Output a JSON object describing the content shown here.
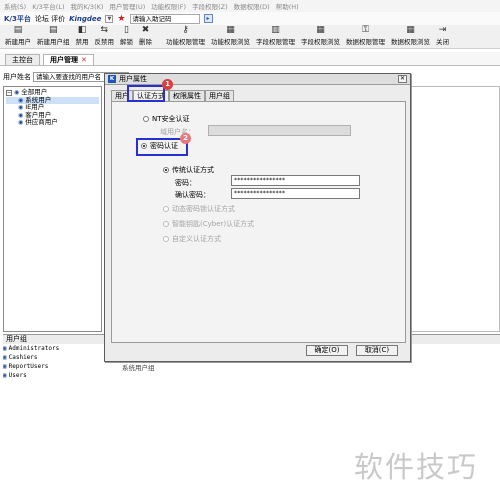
{
  "menubar": [
    "系统(S)",
    "K/3平台(L)",
    "我的K/3(K)",
    "用户管理(U)",
    "功能权限(F)",
    "字段权限(Z)",
    "数据权限(D)",
    "帮助(H)"
  ],
  "brand": {
    "name": "K/3平台",
    "links": "论坛 评价",
    "logo": "Kingdee",
    "quick_placeholder": "请输入助记码"
  },
  "toolbar": [
    "新建用户",
    "新建用户组",
    "禁用",
    "反禁用",
    "解锁",
    "删除",
    "功能权限管理",
    "功能权限浏览",
    "字段权限管理",
    "字段权限浏览",
    "数据权限管理",
    "数据权限浏览",
    "关闭"
  ],
  "doc_tabs": {
    "console": "主控台",
    "user_mgmt": "用户管理"
  },
  "search": {
    "label": "用户姓名",
    "placeholder": "请输入要查找的用户名"
  },
  "tree": {
    "root": "全部用户",
    "children": [
      "系统用户",
      "IE用户",
      "客户用户",
      "供应商用户"
    ]
  },
  "groups": {
    "header": "用户组",
    "items": [
      "Administrators",
      "Cashiers",
      "ReportUsers",
      "Users"
    ],
    "below_text": "系统用户组"
  },
  "dialog": {
    "title": "用户属性",
    "tabs": [
      "用户",
      "认证方式",
      "权限属性",
      "用户组"
    ],
    "nt_auth": "NT安全认证",
    "domain_label": "域用户名：",
    "password_auth": "密码认证",
    "traditional": "传统认证方式",
    "password_label": "密码：",
    "confirm_label": "确认密码：",
    "password_mask": "****************",
    "confirm_mask": "****************",
    "opt_dynamic": "动态密码锁认证方式",
    "opt_smartcard": "智能钥匙(Cyber)认证方式",
    "opt_custom": "自定义认证方式",
    "ok": "确定(O)",
    "cancel": "取消(C)"
  },
  "annotations": {
    "badge1": "1",
    "badge2": "2"
  },
  "watermark": "软件技巧",
  "colors": {
    "highlight": "#2a2fd2",
    "badge1": "#d84040",
    "badge2": "#e9787c"
  }
}
